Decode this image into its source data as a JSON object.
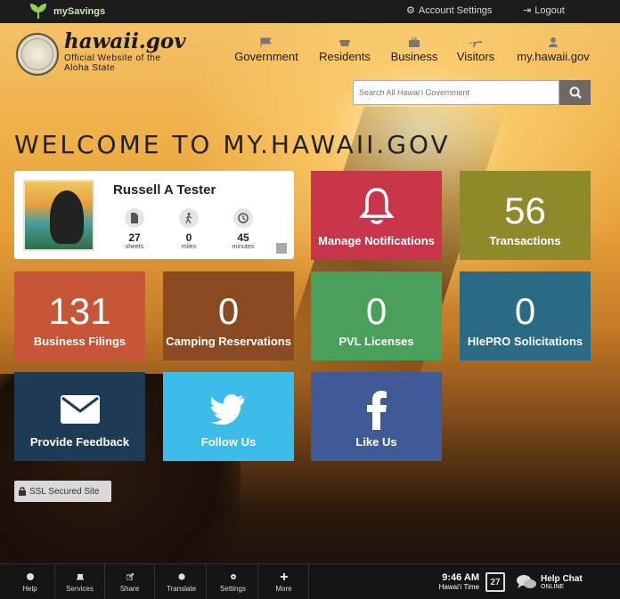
{
  "topbar": {
    "brand": "mySavings",
    "account_settings": "Account Settings",
    "logout": "Logout"
  },
  "header": {
    "logo_title": "hawaii.gov",
    "logo_subtitle": "Official Website of the Aloha State",
    "nav": [
      {
        "label": "Government",
        "icon": "flag-icon"
      },
      {
        "label": "Residents",
        "icon": "basket-icon"
      },
      {
        "label": "Business",
        "icon": "briefcase-icon"
      },
      {
        "label": "Visitors",
        "icon": "plane-icon"
      },
      {
        "label": "my.hawaii.gov",
        "icon": "user-icon"
      }
    ],
    "search_placeholder": "Search All Hawaiʻi Government"
  },
  "welcome": "WELCOME TO MY.HAWAII.GOV",
  "profile": {
    "name": "Russell A Tester",
    "stats": [
      {
        "value": "27",
        "unit": "sheets",
        "icon": "document-icon"
      },
      {
        "value": "0",
        "unit": "miles",
        "icon": "walking-icon"
      },
      {
        "value": "45",
        "unit": "minutes",
        "icon": "clock-icon"
      }
    ]
  },
  "tiles": {
    "notifications": {
      "label": "Manage Notifications",
      "color": "#c8354a"
    },
    "transactions": {
      "value": "56",
      "label": "Transactions",
      "color": "#8e8a2c"
    },
    "business_filings": {
      "value": "131",
      "label": "Business Filings",
      "color": "#c75638"
    },
    "camping": {
      "value": "0",
      "label": "Camping Reservations",
      "color": "#8a4a22"
    },
    "pvl": {
      "value": "0",
      "label": "PVL Licenses",
      "color": "#4aa05a"
    },
    "hiepro": {
      "value": "0",
      "label": "HIePRO Solicitations",
      "color": "#2a6a85"
    },
    "feedback": {
      "label": "Provide Feedback",
      "color": "#1f3a55"
    },
    "twitter": {
      "label": "Follow Us",
      "color": "#3cbce8"
    },
    "facebook": {
      "label": "Like Us",
      "color": "#3f5a96"
    }
  },
  "ssl": "SSL Secured Site",
  "bottombar": {
    "items": [
      "Help",
      "Services",
      "Share",
      "Translate",
      "Settings",
      "More"
    ],
    "time": "9:46 AM",
    "timezone": "Hawaiʻi Time",
    "date": "27",
    "help_chat": "Help Chat",
    "help_status": "ONLINE"
  }
}
